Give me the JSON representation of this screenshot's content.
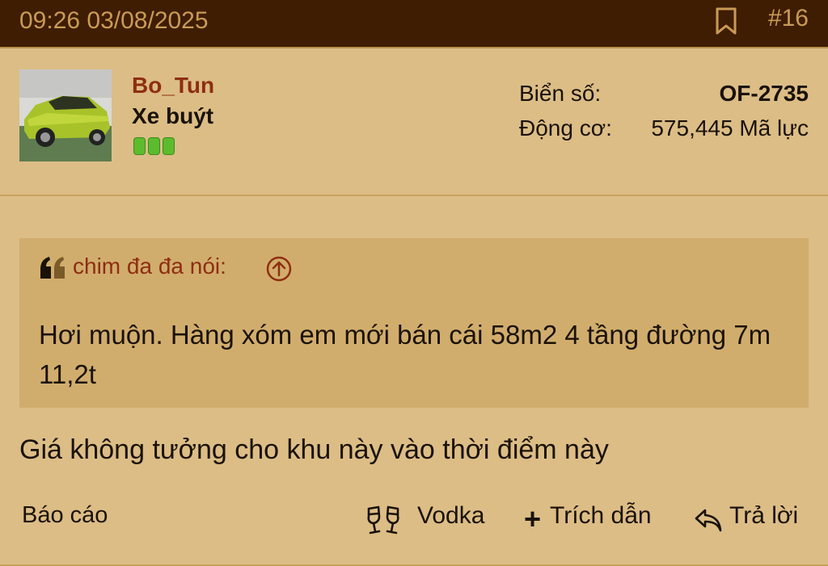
{
  "header": {
    "timestamp": "09:26 03/08/2025",
    "post_number": "#16",
    "bookmark_icon": "bookmark-icon"
  },
  "user": {
    "avatar_icon": "car-avatar",
    "name": "Bo_Tun",
    "title": "Xe buýt",
    "rank_level": 3
  },
  "vehicle": {
    "plate_label": "Biển số:",
    "plate_value": "OF-2735",
    "engine_label": "Động cơ:",
    "engine_value": "575,445 Mã lực"
  },
  "quote": {
    "author": "chim đa đa nói:",
    "text": "Hơi muộn. Hàng xóm em mới bán cái 58m2 4 tầng đường 7m 11,2t"
  },
  "post": {
    "body": "Giá không tưởng cho khu này vào thời điểm này"
  },
  "actions": {
    "report": "Báo cáo",
    "vodka": "Vodka",
    "quote": "Trích dẫn",
    "reply": "Trả lời"
  },
  "colors": {
    "header_bg": "#3f1d03",
    "page_bg": "#dcbd86",
    "quote_bg": "#d1ad6d",
    "accent": "#8e2e10"
  }
}
